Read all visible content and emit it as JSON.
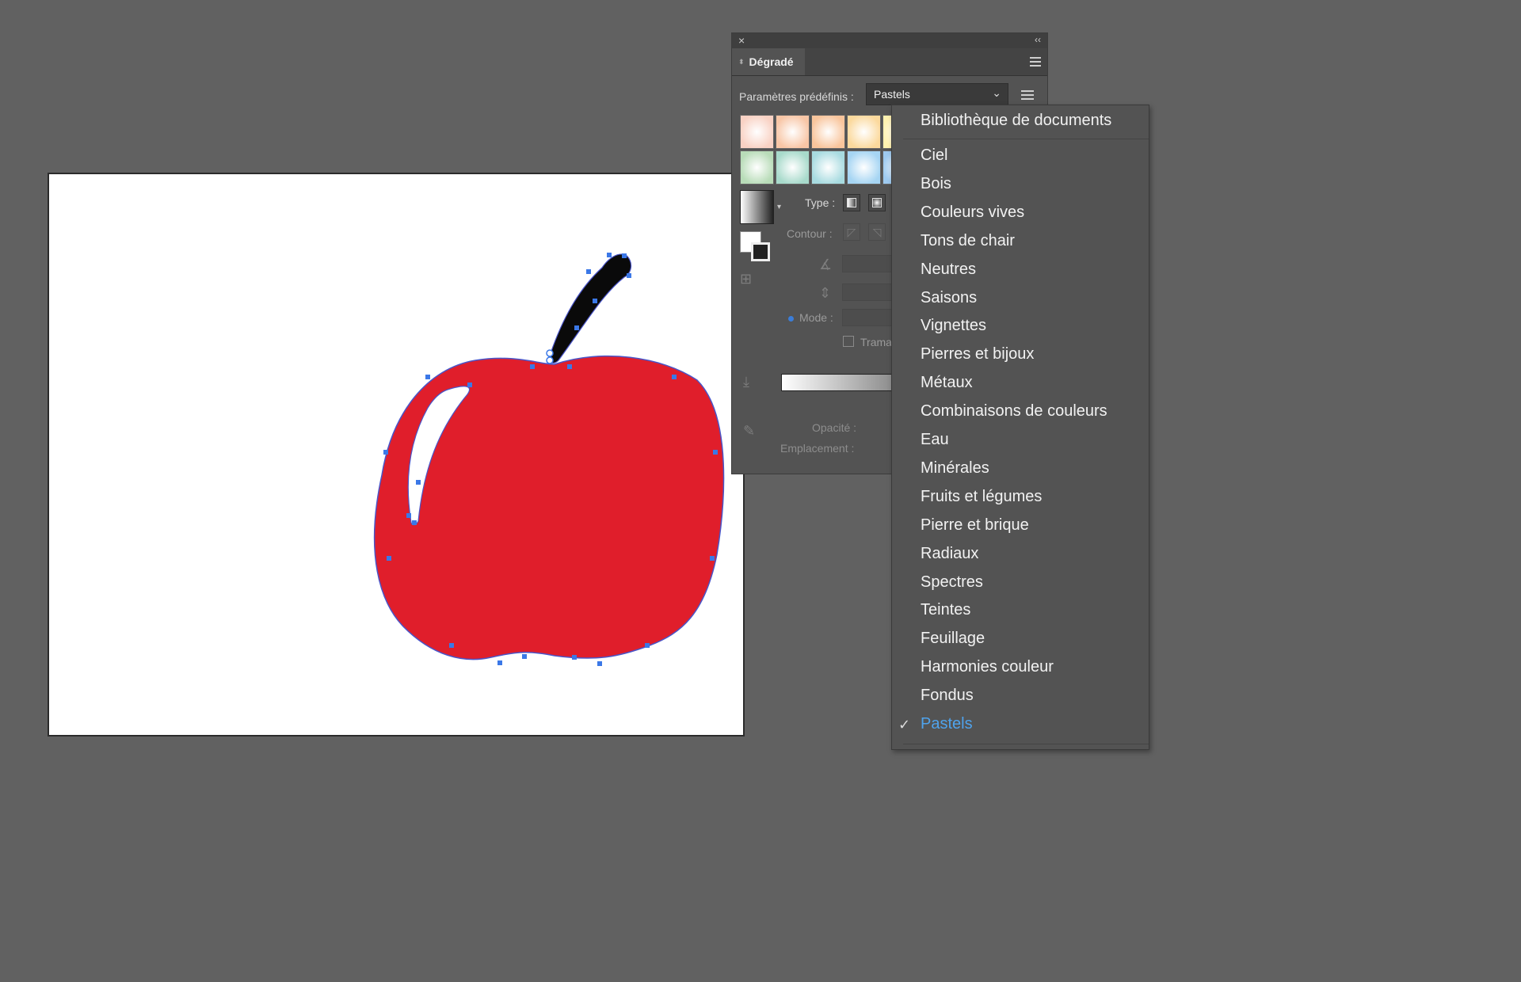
{
  "panel": {
    "close_icon": "×",
    "collapse_icon": "‹‹",
    "tab_title": "Dégradé",
    "presets_label": "Paramètres prédéfinis :",
    "presets_value": "Pastels",
    "type_label": "Type :",
    "contour_label": "Contour :",
    "mode_label": "Mode :",
    "trama_label": "Trama",
    "opacity_label": "Opacité :",
    "location_label": "Emplacement :",
    "swatch_colors": [
      [
        "#f9d2c4",
        "#f8c6a6",
        "#f9c59c",
        "#fbd99d",
        "#fff2b0"
      ],
      [
        "#b8dcb8",
        "#a8dacb",
        "#a8dbe0",
        "#a6d5f3",
        "#9ecaf0"
      ]
    ]
  },
  "menu": {
    "header": "Bibliothèque de documents",
    "items": [
      "Ciel",
      "Bois",
      "Couleurs vives",
      "Tons de chair",
      "Neutres",
      "Saisons",
      "Vignettes",
      "Pierres et bijoux",
      "Métaux",
      "Combinaisons de couleurs",
      "Eau",
      "Minérales",
      "Fruits et légumes",
      "Pierre et brique",
      "Radiaux",
      "Spectres",
      "Teintes",
      "Feuillage",
      "Harmonies couleur",
      "Fondus"
    ],
    "checked_item": "Pastels",
    "check_icon": "✓"
  },
  "artwork": {
    "apple_color": "#e01e2b",
    "stem_color": "#0a0a0a",
    "anchor_color": "#3b78e7"
  }
}
